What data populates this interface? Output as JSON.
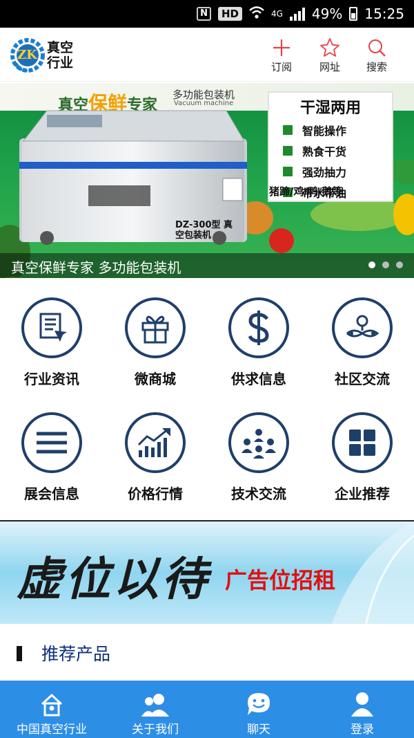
{
  "status_bar": {
    "network": "4G",
    "hd": "HD",
    "battery": "49%",
    "time": "15:25"
  },
  "header": {
    "logo_badge": "ZK",
    "logo_text": "真空行业",
    "actions": [
      {
        "label": "订阅",
        "icon": "plus-icon"
      },
      {
        "label": "网址",
        "icon": "star-icon"
      },
      {
        "label": "搜索",
        "icon": "search-icon"
      }
    ]
  },
  "banner": {
    "title_prefix": "真空",
    "title_highlight": "保鲜",
    "title_suffix": "专家",
    "subtitle": "多功能包装机",
    "subtitle_en": "Vacuum machine",
    "machine_label": "DZ-300型 真空包装机",
    "feature_head": "干湿两用",
    "features": [
      "智能操作",
      "熟食干货",
      "强劲抽力",
      "带水带油"
    ],
    "feature_foot": "猪蹄/鸡/鸭/鹅等",
    "caption": "真空保鲜专家 多功能包装机",
    "slide_count": 3,
    "active_slide": 1
  },
  "menu": [
    {
      "label": "行业资讯",
      "icon": "news-document-icon"
    },
    {
      "label": "微商城",
      "icon": "gift-icon"
    },
    {
      "label": "供求信息",
      "icon": "dollar-icon"
    },
    {
      "label": "社区交流",
      "icon": "community-icon"
    },
    {
      "label": "展会信息",
      "icon": "list-icon"
    },
    {
      "label": "价格行情",
      "icon": "trend-chart-icon"
    },
    {
      "label": "技术交流",
      "icon": "people-network-icon"
    },
    {
      "label": "企业推荐",
      "icon": "grid-icon"
    }
  ],
  "ad": {
    "main": "虚位以待",
    "sub": "广告位招租"
  },
  "section": {
    "title": "推荐产品"
  },
  "nav": [
    {
      "label": "中国真空行业",
      "icon": "home-icon"
    },
    {
      "label": "关于我们",
      "icon": "users-icon"
    },
    {
      "label": "聊天",
      "icon": "chat-icon"
    },
    {
      "label": "登录",
      "icon": "user-icon"
    }
  ],
  "colors": {
    "accent": "#2d8ee6",
    "menu_icon": "#1f3f6b",
    "header_icon": "#e8414a",
    "section_title": "#0d2f7a",
    "ad_red": "#e01010"
  }
}
